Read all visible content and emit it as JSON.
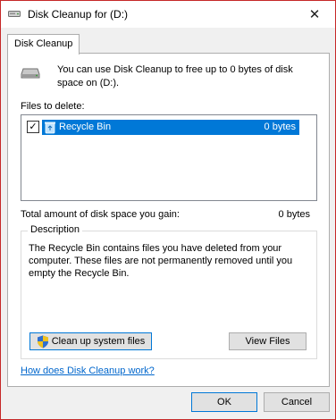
{
  "window": {
    "title": "Disk Cleanup for  (D:)",
    "close_glyph": "✕"
  },
  "tab": {
    "label": "Disk Cleanup"
  },
  "intro": {
    "text": "You can use Disk Cleanup to free up to 0 bytes of disk space on  (D:)."
  },
  "files": {
    "label": "Files to delete:",
    "items": [
      {
        "checked": true,
        "name": "Recycle Bin",
        "size": "0 bytes",
        "icon": "recycle-bin-icon"
      }
    ]
  },
  "total": {
    "label": "Total amount of disk space you gain:",
    "value": "0 bytes"
  },
  "description": {
    "legend": "Description",
    "text": "The Recycle Bin contains files you have deleted from your computer. These files are not permanently removed until you empty the Recycle Bin."
  },
  "buttons": {
    "cleanup_system": "Clean up system files",
    "view_files": "View Files",
    "ok": "OK",
    "cancel": "Cancel"
  },
  "help_link": "How does Disk Cleanup work?",
  "colors": {
    "selection": "#0078d7",
    "link": "#0066cc",
    "frame_border": "#c62828"
  }
}
